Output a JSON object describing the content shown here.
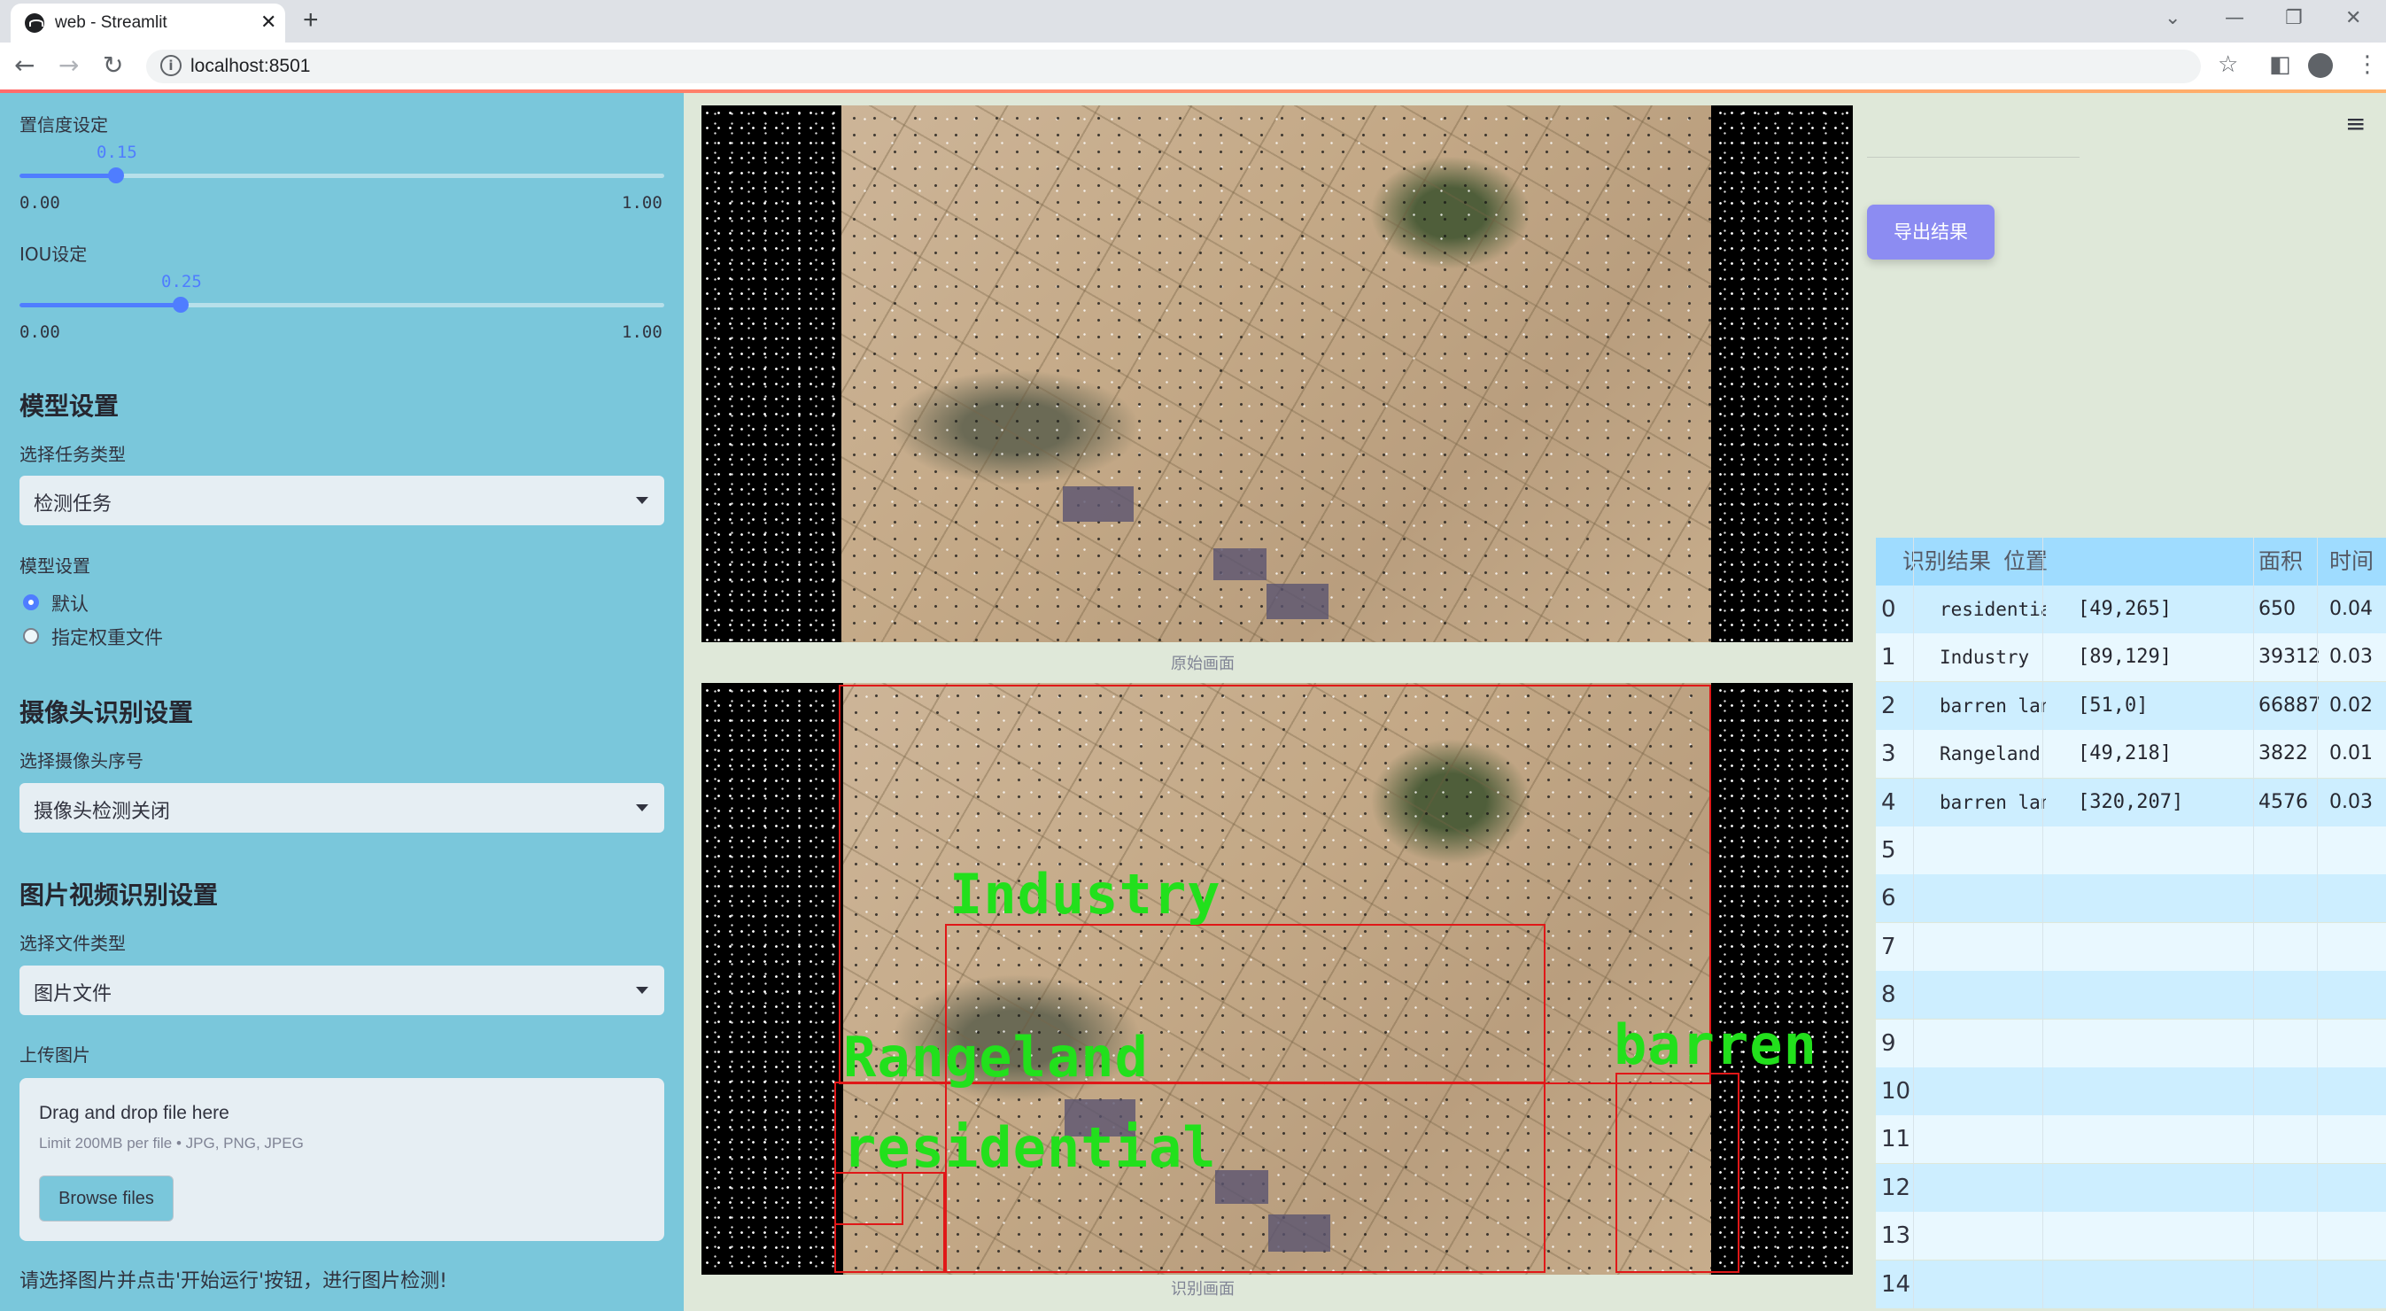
{
  "browser": {
    "tab_title": "web - Streamlit",
    "url": "localhost:8501"
  },
  "sidebar": {
    "confidence": {
      "label": "置信度设定",
      "value": "0.15",
      "fraction": 0.15,
      "min": "0.00",
      "max": "1.00"
    },
    "iou": {
      "label": "IOU设定",
      "value": "0.25",
      "fraction": 0.25,
      "min": "0.00",
      "max": "1.00"
    },
    "model_section": "模型设置",
    "task_type_label": "选择任务类型",
    "task_type_value": "检测任务",
    "model_settings_label": "模型设置",
    "radio_default": "默认",
    "radio_custom": "指定权重文件",
    "camera_section": "摄像头识别设置",
    "camera_label": "选择摄像头序号",
    "camera_value": "摄像头检测关闭",
    "media_section": "图片视频识别设置",
    "file_type_label": "选择文件类型",
    "file_type_value": "图片文件",
    "upload_label": "上传图片",
    "dropzone_title": "Drag and drop file here",
    "dropzone_limit": "Limit 200MB per file • JPG, PNG, JPEG",
    "browse_label": "Browse files",
    "hint": "请选择图片并点击'开始运行'按钮，进行图片检测!"
  },
  "main": {
    "original_caption": "原始画面",
    "result_caption": "识别画面",
    "export_label": "导出结果",
    "detections": {
      "industry": "Industry",
      "rangeland": "Rangeland",
      "residential": "residential",
      "barren": "barren"
    }
  },
  "table": {
    "headers": {
      "label": "识别结果",
      "pos": "位置",
      "area": "面积",
      "time": "时间"
    },
    "rows": [
      {
        "idx": "0",
        "label": "residential",
        "pos": "[49,265]",
        "area": "650",
        "time": "0.04"
      },
      {
        "idx": "1",
        "label": "Industry",
        "pos": "[89,129]",
        "area": "39312",
        "time": "0.03"
      },
      {
        "idx": "2",
        "label": "barren land",
        "pos": "[51,0]",
        "area": "66887",
        "time": "0.02"
      },
      {
        "idx": "3",
        "label": "Rangeland",
        "pos": "[49,218]",
        "area": "3822",
        "time": "0.01"
      },
      {
        "idx": "4",
        "label": "barren land",
        "pos": "[320,207]",
        "area": "4576",
        "time": "0.03"
      },
      {
        "idx": "5"
      },
      {
        "idx": "6"
      },
      {
        "idx": "7"
      },
      {
        "idx": "8"
      },
      {
        "idx": "9"
      },
      {
        "idx": "10"
      },
      {
        "idx": "11"
      },
      {
        "idx": "12"
      },
      {
        "idx": "13"
      },
      {
        "idx": "14"
      }
    ]
  }
}
